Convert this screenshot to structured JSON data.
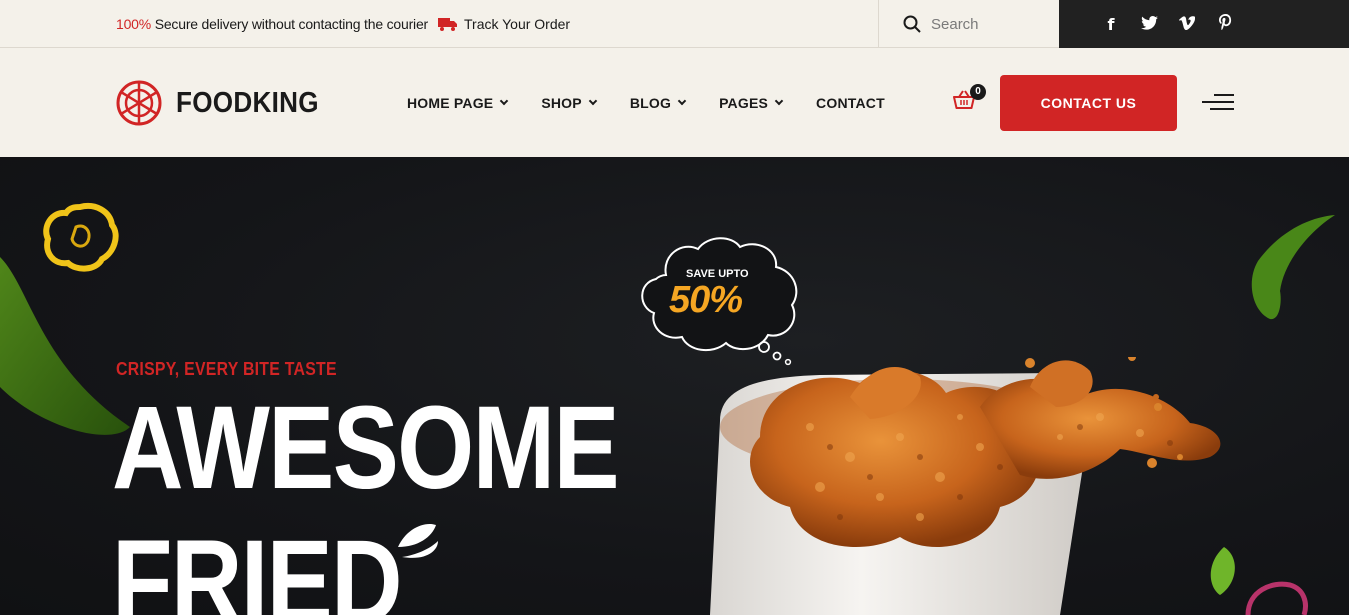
{
  "topbar": {
    "promo_percent": "100%",
    "promo_text": " Secure delivery without contacting the courier",
    "track_label": "Track Your Order",
    "search_placeholder": "Search",
    "social_icons": [
      "facebook-icon",
      "twitter-icon",
      "vimeo-icon",
      "pinterest-icon"
    ]
  },
  "header": {
    "logo_text": "FOODKING",
    "nav": [
      {
        "label": "HOME PAGE",
        "has_dropdown": true
      },
      {
        "label": "SHOP",
        "has_dropdown": true
      },
      {
        "label": "BLOG",
        "has_dropdown": true
      },
      {
        "label": "PAGES",
        "has_dropdown": true
      },
      {
        "label": "CONTACT",
        "has_dropdown": false
      }
    ],
    "cart_count": "0",
    "cta_label": "CONTACT US"
  },
  "hero": {
    "tagline": "CRISPY, EVERY BITE TASTE",
    "title_line1": "AWESOME",
    "title_line2": "FRIED",
    "bubble_small": "SAVE UPTO",
    "bubble_big": "50%"
  },
  "colors": {
    "accent": "#d12525",
    "dark": "#1a1a1a",
    "cream": "#f4f1ea",
    "hero_bg": "#141518",
    "highlight": "#f5a623"
  }
}
